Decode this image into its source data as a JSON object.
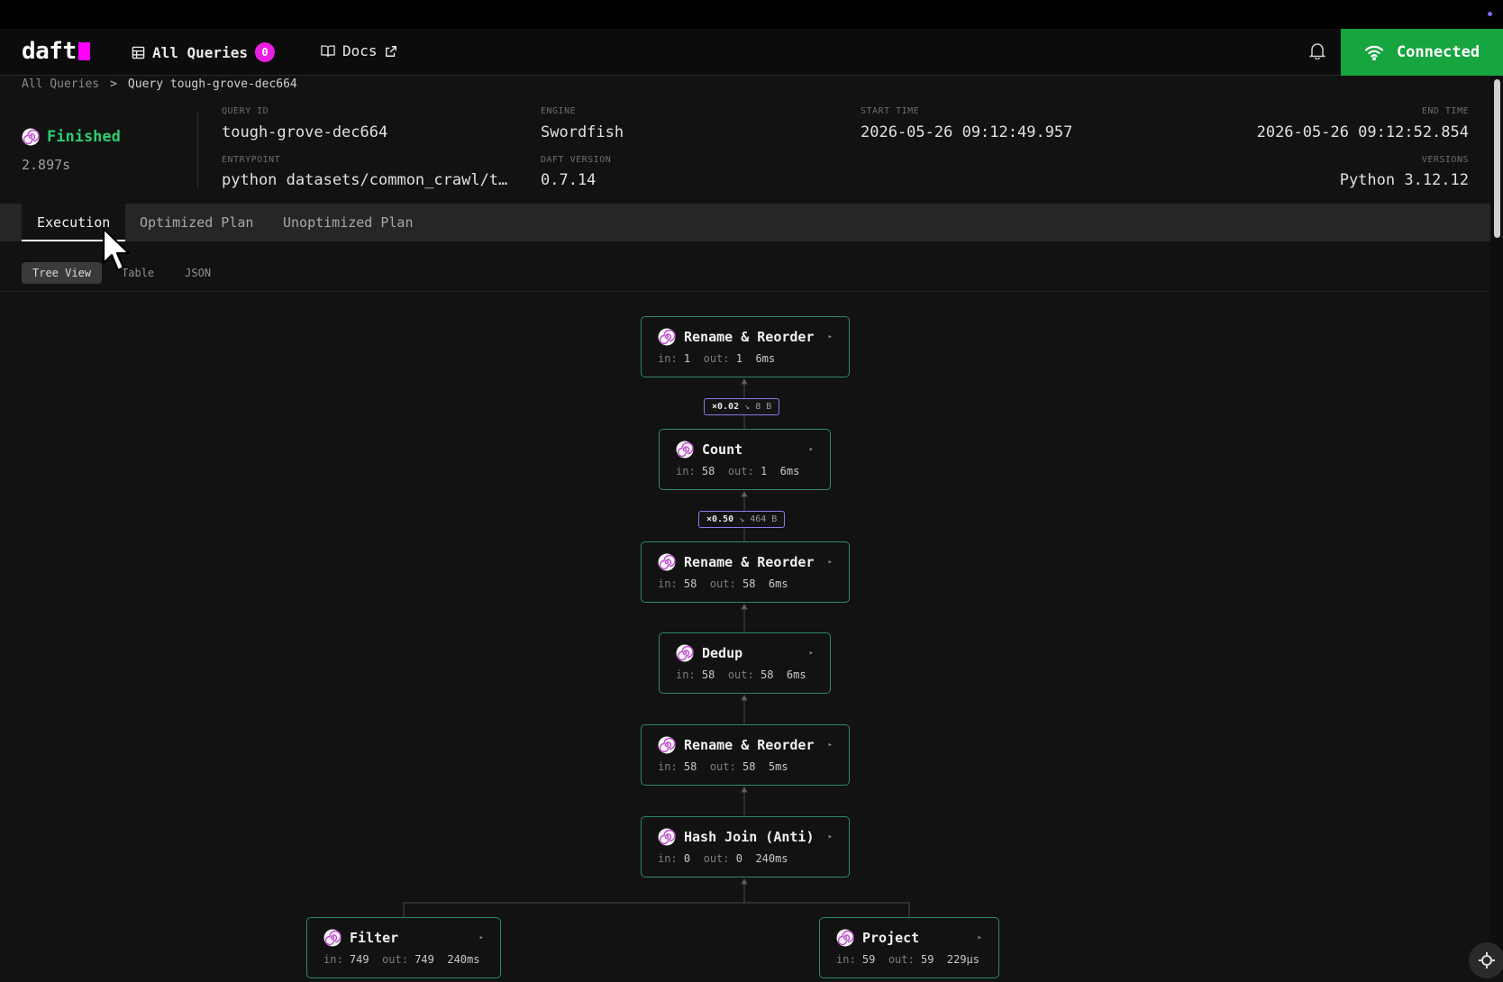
{
  "app": {
    "logo_text": "daft",
    "nav": {
      "all_queries_label": "All Queries",
      "all_queries_count": "0",
      "docs_label": "Docs"
    },
    "connection_status": "Connected"
  },
  "breadcrumb": {
    "root": "All Queries",
    "separator": ">",
    "current": "Query tough-grove-dec664"
  },
  "query": {
    "status": "Finished",
    "duration": "2.897s",
    "fields": {
      "query_id_label": "QUERY ID",
      "query_id": "tough-grove-dec664",
      "entrypoint_label": "ENTRYPOINT",
      "entrypoint": "python datasets/common_crawl/t…",
      "engine_label": "ENGINE",
      "engine": "Swordfish",
      "daft_version_label": "DAFT VERSION",
      "daft_version": "0.7.14",
      "start_time_label": "START TIME",
      "start_time": "2026-05-26 09:12:49.957",
      "end_time_label": "END TIME",
      "end_time": "2026-05-26 09:12:52.854",
      "versions_label": "VERSIONS",
      "versions": "Python 3.12.12"
    }
  },
  "tabs": [
    "Execution",
    "Optimized Plan",
    "Unoptimized Plan"
  ],
  "active_tab": "Execution",
  "view_modes": [
    "Tree View",
    "Table",
    "JSON"
  ],
  "active_view_mode": "Tree View",
  "plan": {
    "in_label": "in:",
    "out_label": "out:",
    "nodes": [
      {
        "name": "Rename & Reorder",
        "in": "1",
        "out": "1",
        "time": "6ms"
      },
      {
        "name": "Count",
        "in": "58",
        "out": "1",
        "time": "6ms"
      },
      {
        "name": "Rename & Reorder",
        "in": "58",
        "out": "58",
        "time": "6ms"
      },
      {
        "name": "Dedup",
        "in": "58",
        "out": "58",
        "time": "6ms"
      },
      {
        "name": "Rename & Reorder",
        "in": "58",
        "out": "58",
        "time": "5ms"
      },
      {
        "name": "Hash Join (Anti)",
        "in": "0",
        "out": "0",
        "time": "240ms"
      },
      {
        "name": "Filter",
        "in": "749",
        "out": "749",
        "time": "240ms"
      },
      {
        "name": "Project",
        "in": "59",
        "out": "59",
        "time": "229µs"
      }
    ],
    "ratios": [
      {
        "factor": "×0.02",
        "arrow": "↘",
        "bytes": "8 B"
      },
      {
        "factor": "×0.50",
        "arrow": "↘",
        "bytes": "464 B"
      }
    ]
  },
  "colors": {
    "finished_green": "#2ecc71",
    "connected_bg": "#17a540",
    "badge_magenta": "#e91ee0",
    "node_border": "#2f8b60",
    "ratio_border": "#8a7be8"
  },
  "icons": [
    "table-icon",
    "book-icon",
    "external-link-icon",
    "bell-icon",
    "wifi-icon",
    "spiral-icon",
    "chevron-right-icon",
    "play-arrow-icon"
  ]
}
